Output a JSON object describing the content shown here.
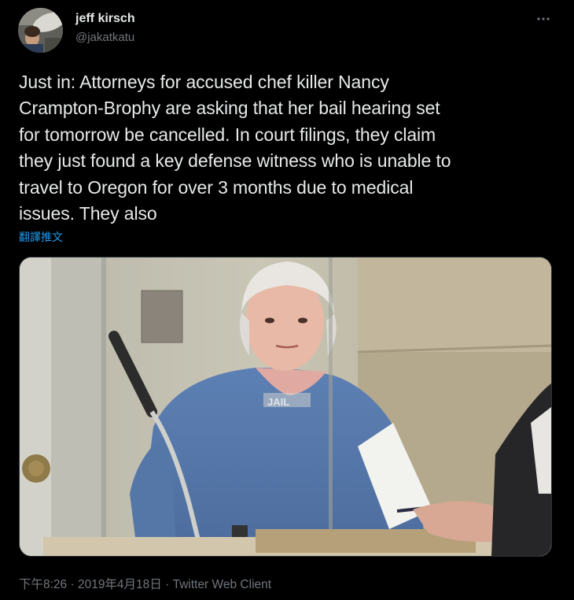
{
  "author": {
    "display_name": "jeff kirsch",
    "handle": "@jakatkatu"
  },
  "icons": {
    "avatar": "user-avatar",
    "more": "more-horizontal-icon"
  },
  "tweet": {
    "text": "Just in: Attorneys for accused chef killer Nancy\nCrampton-Brophy are asking that her bail hearing set\nfor tomorrow be cancelled. In court filings, they claim\nthey just found a key defense witness who is unable to\ntravel to Oregon for over 3 months due to medical\nissues. They also",
    "translate_label": "翻譯推文"
  },
  "media": {
    "glass_text": "JAIL"
  },
  "meta": {
    "time": "下午8:26",
    "separator1": " · ",
    "date": "2019年4月18日",
    "separator2": " · ",
    "client": "Twitter Web Client"
  },
  "colors": {
    "background": "#000000",
    "text": "#e7e9ea",
    "secondary_text": "#71767b",
    "link": "#1d9bf0"
  }
}
